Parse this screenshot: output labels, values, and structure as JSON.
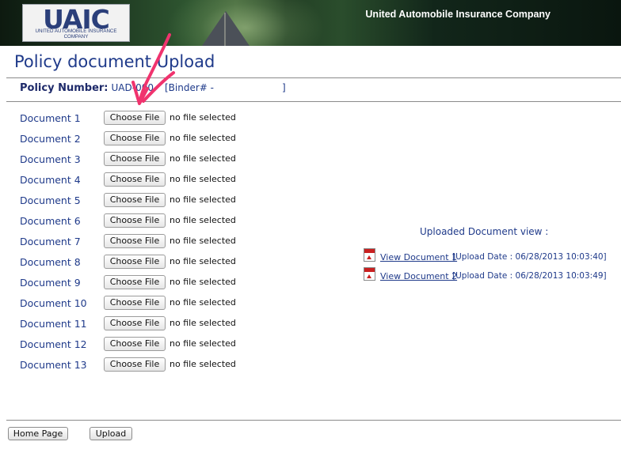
{
  "header": {
    "logo_text": "UAIC",
    "logo_subtitle": "UNITED AUTOMOBILE INSURANCE COMPANY",
    "company_name": "United Automobile Insurance Company"
  },
  "page": {
    "title": "Policy document Upload"
  },
  "policy": {
    "label": "Policy Number:",
    "number": "UAD-000",
    "binder": "[Binder# -"
  },
  "documents": [
    {
      "label": "Document 1",
      "button": "Choose File",
      "status": "no file selected"
    },
    {
      "label": "Document 2",
      "button": "Choose File",
      "status": "no file selected"
    },
    {
      "label": "Document 3",
      "button": "Choose File",
      "status": "no file selected"
    },
    {
      "label": "Document 4",
      "button": "Choose File",
      "status": "no file selected"
    },
    {
      "label": "Document 5",
      "button": "Choose File",
      "status": "no file selected"
    },
    {
      "label": "Document 6",
      "button": "Choose File",
      "status": "no file selected"
    },
    {
      "label": "Document 7",
      "button": "Choose File",
      "status": "no file selected"
    },
    {
      "label": "Document 8",
      "button": "Choose File",
      "status": "no file selected"
    },
    {
      "label": "Document 9",
      "button": "Choose File",
      "status": "no file selected"
    },
    {
      "label": "Document 10",
      "button": "Choose File",
      "status": "no file selected"
    },
    {
      "label": "Document 11",
      "button": "Choose File",
      "status": "no file selected"
    },
    {
      "label": "Document 12",
      "button": "Choose File",
      "status": "no file selected"
    },
    {
      "label": "Document 13",
      "button": "Choose File",
      "status": "no file selected"
    }
  ],
  "uploaded": {
    "title": "Uploaded Document view :",
    "items": [
      {
        "link": "View Document 1",
        "date": "[Upload Date : 06/28/2013 10:03:40]",
        "icon": "pdf-icon"
      },
      {
        "link": "View Document 2",
        "date": "[Upload Date : 06/28/2013 10:03:49]",
        "icon": "pdf-icon"
      }
    ]
  },
  "footer": {
    "home_label": "Home Page",
    "upload_label": "Upload"
  },
  "colors": {
    "accent": "#1f3a8a",
    "annotation_arrow": "#f0336e"
  }
}
